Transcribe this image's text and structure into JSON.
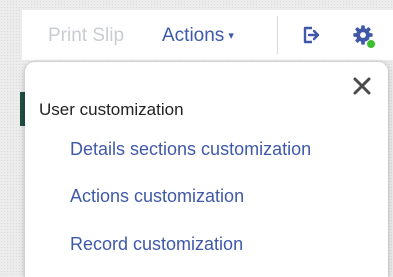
{
  "toolbar": {
    "print_slip_label": "Print Slip",
    "actions_label": "Actions",
    "actions_caret": "▾",
    "exit_icon": "sign-out-icon",
    "settings_icon": "gear-icon",
    "status_color": "#3cbf2f"
  },
  "panel": {
    "close_glyph": "✕",
    "section_title": "User customization",
    "items": [
      {
        "label": "Details sections customization"
      },
      {
        "label": "Actions customization"
      },
      {
        "label": "Record customization"
      }
    ]
  },
  "colors": {
    "link": "#3f59a8",
    "disabled": "#c9ccd1",
    "text": "#222222",
    "icon": "#3f59a8"
  }
}
